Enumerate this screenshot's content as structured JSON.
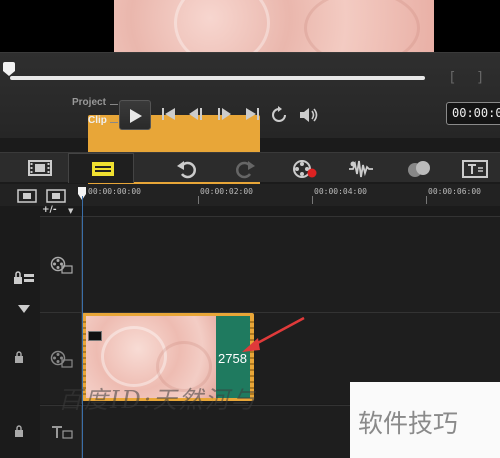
{
  "player": {
    "project_label": "Project",
    "clip_label": "Clip",
    "timecode": "00:00:0",
    "bracket_in": "[",
    "bracket_out": "]"
  },
  "timeline": {
    "add_remove": "+/-",
    "ruler_labels": [
      "00:00:00:00",
      "00:00:02:00",
      "00:00:04:00",
      "00:00:06:00"
    ]
  },
  "clip": {
    "number": "2758"
  },
  "watermarks": {
    "overlay": "百度ID:天然河与",
    "box": "软件技巧"
  },
  "colors": {
    "clip_frame": "#e8a638",
    "clip_green": "#1f7a5f",
    "timeline_highlight": "#f0e030",
    "arrow": "#e03a3a",
    "playhead": "#3a6ea8"
  }
}
